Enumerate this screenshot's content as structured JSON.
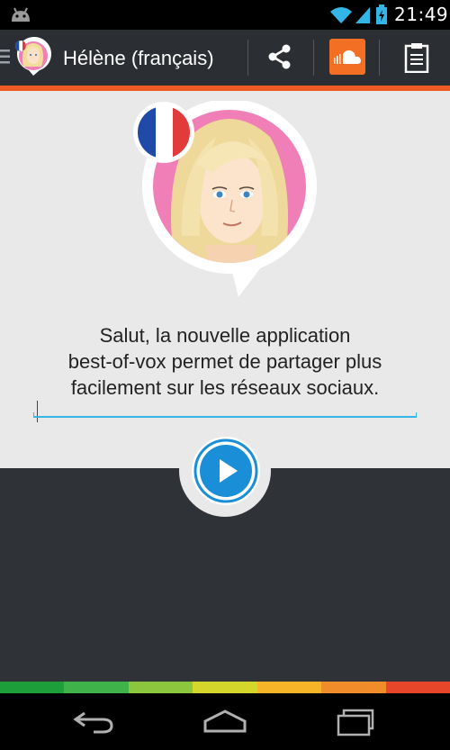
{
  "status_bar": {
    "time": "21:49",
    "icons": [
      "android-icon",
      "wifi-icon",
      "signal-icon",
      "battery-icon"
    ]
  },
  "action_bar": {
    "title": "Hélène (français)",
    "icons": [
      "hamburger-icon",
      "avatar-helene",
      "france-flag-icon",
      "share-icon",
      "soundcloud-icon",
      "clipboard-icon"
    ],
    "accent_color": "#ee5a24",
    "soundcloud_color": "#f26f23"
  },
  "main": {
    "speech_lines": [
      "Salut, la nouvelle application",
      "best-of-vox permet de partager plus",
      "facilement sur les réseaux sociaux."
    ],
    "input_accent_color": "#33b5e5",
    "play_button_color": "#1a8fd8",
    "avatar_ring_color": "#ef7fb6"
  },
  "color_strip": [
    "#1e9e3a",
    "#3fb24a",
    "#8cc63f",
    "#d4d62c",
    "#f6b429",
    "#f08c2a",
    "#e8462b"
  ],
  "nav_bar": {
    "icons": [
      "back-icon",
      "home-icon",
      "recent-apps-icon"
    ]
  }
}
